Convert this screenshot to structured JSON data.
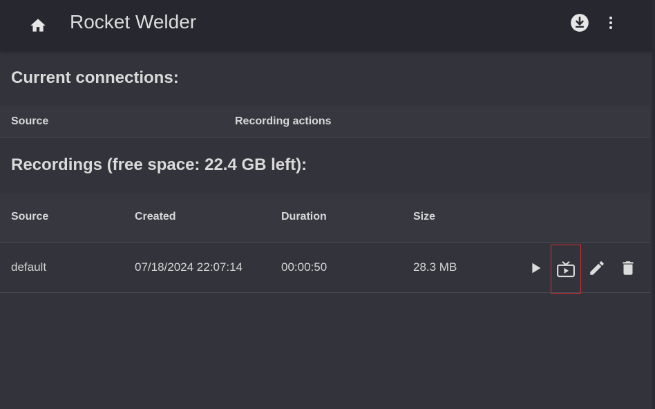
{
  "app": {
    "title": "Rocket Welder"
  },
  "appbar": {
    "icons": [
      "home-icon",
      "download-icon",
      "more-vert-icon"
    ]
  },
  "current_connections": {
    "title": "Current connections:",
    "columns": [
      "Source",
      "Recording actions"
    ]
  },
  "recordings": {
    "title": "Recordings (free space: 22.4 GB left):",
    "columns": [
      "Source",
      "Created",
      "Duration",
      "Size"
    ],
    "rows": [
      {
        "source": "default",
        "created": "07/18/2024 22:07:14",
        "duration": "00:00:50",
        "size": "28.3 MB",
        "actions": [
          "play-icon",
          "live-tv-icon",
          "edit-icon",
          "delete-icon"
        ]
      }
    ]
  },
  "colors": {
    "background": "#33333b",
    "appbar": "#27272f",
    "header_row": "#373740",
    "highlight_border": "#d32f2f",
    "text": "#e0e0e0"
  }
}
